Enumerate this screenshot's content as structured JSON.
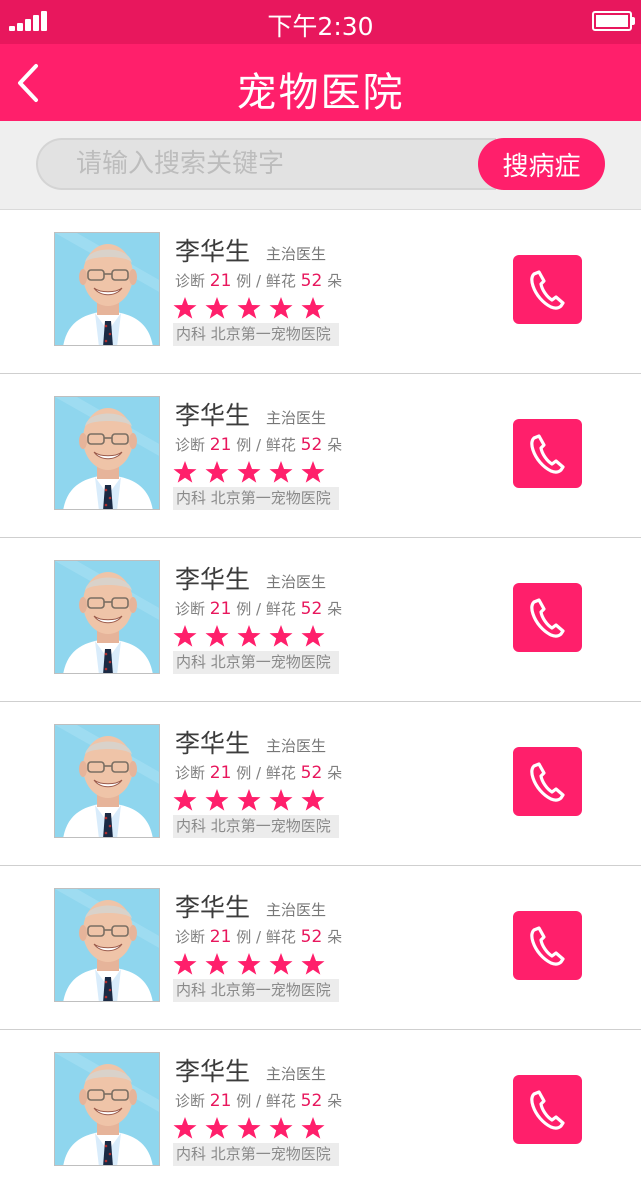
{
  "status": {
    "time": "下午2:30"
  },
  "header": {
    "title": "宠物医院",
    "back": "back"
  },
  "search": {
    "placeholder": "请输入搜索关键字",
    "value": "",
    "button": "搜病症"
  },
  "theme": {
    "accent": "#ff1f6b",
    "status_bar": "#e8175d",
    "number": "#e8175d"
  },
  "icons": {
    "back": "chevron-left-icon",
    "call": "phone-icon",
    "star": "star-icon",
    "signal": "signal-icon",
    "battery": "battery-icon"
  },
  "doctors": [
    {
      "name": "李华生",
      "title": "主治医生",
      "diag_prefix": "诊断",
      "cases": "21",
      "case_unit": "例",
      "sep": "/",
      "flowers_label": "鲜花",
      "flowers": "52",
      "flower_unit": "朵",
      "rating": 5,
      "department": "内科",
      "hospital": "北京第一宠物医院"
    },
    {
      "name": "李华生",
      "title": "主治医生",
      "diag_prefix": "诊断",
      "cases": "21",
      "case_unit": "例",
      "sep": "/",
      "flowers_label": "鲜花",
      "flowers": "52",
      "flower_unit": "朵",
      "rating": 5,
      "department": "内科",
      "hospital": "北京第一宠物医院"
    },
    {
      "name": "李华生",
      "title": "主治医生",
      "diag_prefix": "诊断",
      "cases": "21",
      "case_unit": "例",
      "sep": "/",
      "flowers_label": "鲜花",
      "flowers": "52",
      "flower_unit": "朵",
      "rating": 5,
      "department": "内科",
      "hospital": "北京第一宠物医院"
    },
    {
      "name": "李华生",
      "title": "主治医生",
      "diag_prefix": "诊断",
      "cases": "21",
      "case_unit": "例",
      "sep": "/",
      "flowers_label": "鲜花",
      "flowers": "52",
      "flower_unit": "朵",
      "rating": 5,
      "department": "内科",
      "hospital": "北京第一宠物医院"
    },
    {
      "name": "李华生",
      "title": "主治医生",
      "diag_prefix": "诊断",
      "cases": "21",
      "case_unit": "例",
      "sep": "/",
      "flowers_label": "鲜花",
      "flowers": "52",
      "flower_unit": "朵",
      "rating": 5,
      "department": "内科",
      "hospital": "北京第一宠物医院"
    },
    {
      "name": "李华生",
      "title": "主治医生",
      "diag_prefix": "诊断",
      "cases": "21",
      "case_unit": "例",
      "sep": "/",
      "flowers_label": "鲜花",
      "flowers": "52",
      "flower_unit": "朵",
      "rating": 5,
      "department": "内科",
      "hospital": "北京第一宠物医院"
    }
  ]
}
